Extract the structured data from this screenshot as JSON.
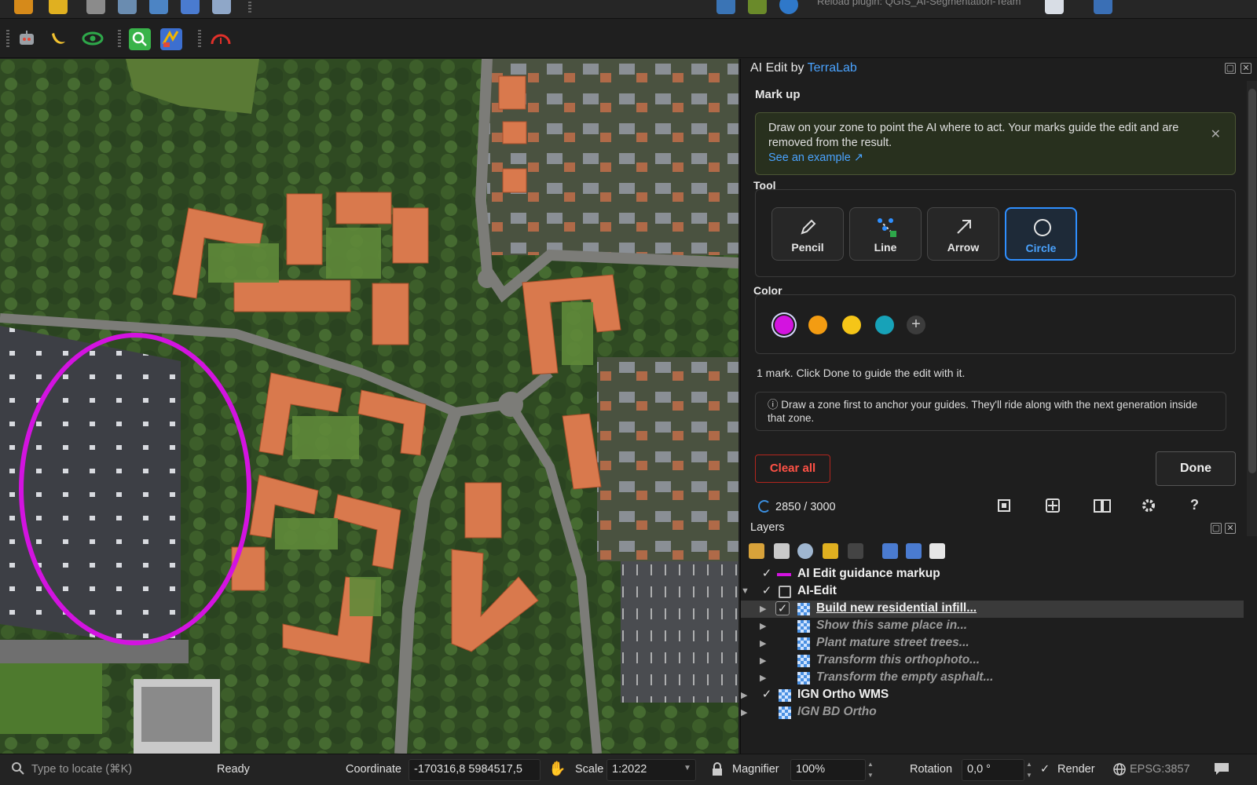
{
  "toolbar_top": {
    "reload_plugin_label": "Reload plugin: QGIS_AI-Segmentation-Team",
    "icons": [
      "add-layer-icon",
      "new-layer-icon",
      "digitize-icon",
      "edit-pen-icon",
      "map-tips-icon",
      "grid-icon",
      "attribute-icon",
      "python-icon",
      "plugin-icon",
      "reload-plugin-icon",
      "help-icon"
    ]
  },
  "toolbar_second": {
    "icons": [
      "robot-icon",
      "banana-icon",
      "eye-icon",
      "zoom-search-icon",
      "puzzle-icon",
      "gauge-icon"
    ]
  },
  "map": {
    "markup_circle_color": "#d313e0",
    "description": "aerial orthophoto"
  },
  "panel": {
    "title_prefix": "AI Edit by ",
    "title_brand": "TerraLab",
    "markup_heading": "Mark up",
    "info_text": "Draw on your zone to point the AI where to act. Your marks guide the edit and are removed from the result.",
    "info_link": "See an example ↗",
    "tool_heading": "Tool",
    "tools": [
      {
        "label": "Pencil",
        "active": false
      },
      {
        "label": "Line",
        "active": false
      },
      {
        "label": "Arrow",
        "active": false
      },
      {
        "label": "Circle",
        "active": true
      }
    ],
    "color_heading": "Color",
    "colors": [
      "#d313e0",
      "#f39c12",
      "#f5c518",
      "#17a2b8"
    ],
    "selected_color": "#d313e0",
    "status_text": "1 mark. Click Done to guide the edit with it.",
    "hint_text": "ⓘ Draw a zone first to anchor your guides. They'll ride along with the next generation inside that zone.",
    "clear_all_label": "Clear all",
    "done_label": "Done",
    "progress_text": "2850 / 3000",
    "progress_fraction": 0.95
  },
  "layers": {
    "title": "Layers",
    "rows": [
      {
        "name": "AI Edit guidance markup",
        "checked": true,
        "expander": false,
        "indent": 0,
        "icon": "line-symbol-icon",
        "style": "bold"
      },
      {
        "name": "AI-Edit",
        "checked": true,
        "expander": true,
        "indent": 0,
        "icon": "group-icon",
        "style": "bold"
      },
      {
        "name": "Build new residential infill...",
        "checked": true,
        "expander": true,
        "indent": 1,
        "icon": "raster-icon",
        "style": "selected"
      },
      {
        "name": "Show this same place in...",
        "checked": false,
        "expander": true,
        "indent": 1,
        "icon": "raster-icon",
        "style": "dim"
      },
      {
        "name": "Plant mature street trees...",
        "checked": false,
        "expander": true,
        "indent": 1,
        "icon": "raster-icon",
        "style": "dim"
      },
      {
        "name": "Transform this orthophoto...",
        "checked": false,
        "expander": true,
        "indent": 1,
        "icon": "raster-icon",
        "style": "dim"
      },
      {
        "name": "Transform the empty asphalt...",
        "checked": false,
        "expander": true,
        "indent": 1,
        "icon": "raster-icon",
        "style": "dim"
      },
      {
        "name": "IGN Ortho WMS",
        "checked": true,
        "expander": true,
        "indent": 0,
        "icon": "raster-icon",
        "style": "bold"
      },
      {
        "name": "IGN BD Ortho",
        "checked": false,
        "expander": true,
        "indent": 0,
        "icon": "raster-icon",
        "style": "dim"
      }
    ]
  },
  "statusbar": {
    "locate_placeholder": "Type to locate (⌘K)",
    "ready": "Ready",
    "coordinate_label": "Coordinate",
    "coordinate_value": "-170316,8  5984517,5",
    "scale_label": "Scale",
    "scale_value": "1:2022",
    "magnifier_label": "Magnifier",
    "magnifier_value": "100%",
    "rotation_label": "Rotation",
    "rotation_value": "0,0 °",
    "render_label": "Render",
    "crs_value": "EPSG:3857"
  }
}
